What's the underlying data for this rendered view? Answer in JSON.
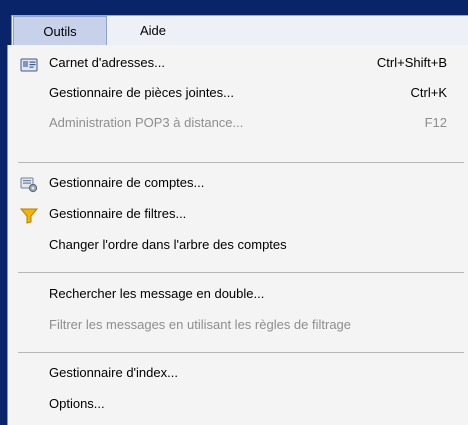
{
  "menubar": {
    "items": [
      {
        "label": "Outils"
      },
      {
        "label": "Aide"
      }
    ]
  },
  "menu": {
    "items": [
      {
        "label": "Carnet d'adresses...",
        "shortcut": "Ctrl+Shift+B",
        "icon": "address-book-icon",
        "enabled": true
      },
      {
        "label": "Gestionnaire de pièces jointes...",
        "shortcut": "Ctrl+K",
        "enabled": true
      },
      {
        "label": "Administration POP3 à distance...",
        "shortcut": "F12",
        "enabled": false
      },
      {
        "label": "Gestionnaire de comptes...",
        "icon": "accounts-icon",
        "enabled": true
      },
      {
        "label": "Gestionnaire de filtres...",
        "icon": "filter-icon",
        "enabled": true
      },
      {
        "label": "Changer l'ordre dans l'arbre des comptes",
        "enabled": true
      },
      {
        "label": "Rechercher les message en double...",
        "enabled": true
      },
      {
        "label": "Filtrer les messages en utilisant les règles de filtrage",
        "enabled": false
      },
      {
        "label": "Gestionnaire d'index...",
        "enabled": true
      },
      {
        "label": "Options...",
        "enabled": true
      }
    ]
  },
  "colors": {
    "background": "#0a246a",
    "menu_bg": "#f4f4f4",
    "disabled_text": "#8e8e8e",
    "filter_icon": "#f2b400"
  }
}
